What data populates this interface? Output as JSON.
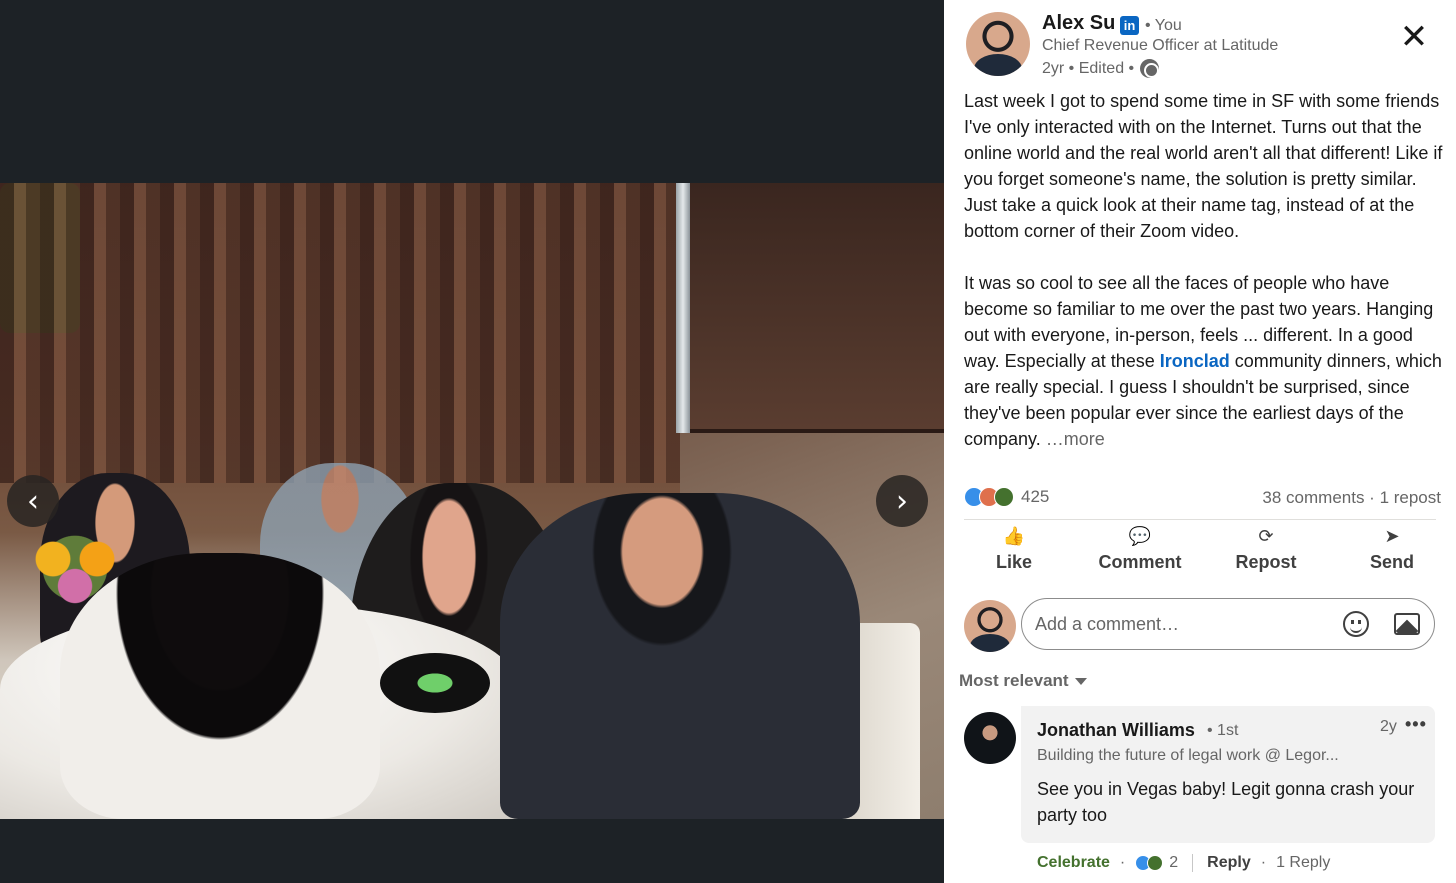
{
  "viewer": {
    "prev_icon": "‹",
    "next_icon": "›"
  },
  "post": {
    "author": {
      "name": "Alex Su",
      "badge": "in",
      "relation": "• You",
      "headline": "Chief Revenue Officer at Latitude",
      "meta": "2yr • Edited •"
    },
    "close_icon": "✕",
    "text": {
      "p1": "Last week I got to spend some time in SF with some friends I've only interacted with on the Internet. Turns out that the online world and the real world aren't all that different! Like if you forget someone's name, the solution is pretty similar. Just take a quick look at their name tag, instead of at the bottom corner of their Zoom video.",
      "p2_before": "It was so cool to see all the faces of people who have become so familiar to me over the past two years. Hanging out with everyone, in-person, feels ... different. In a good way. Especially at these ",
      "p2_mention": "Ironclad",
      "p2_after": " community dinners, which are really special. I guess I shouldn't be surprised, since they've been popular ever since the earliest days of the company.  ",
      "more": "…more"
    },
    "reaction_count": "425",
    "comments": "38 comments",
    "separator": " · ",
    "reposts": "1 repost"
  },
  "actions": [
    {
      "icon": "👍",
      "label": "Like"
    },
    {
      "icon": "💬",
      "label": "Comment"
    },
    {
      "icon": "⟳",
      "label": "Repost"
    },
    {
      "icon": "➤",
      "label": "Send"
    }
  ],
  "comment_input": {
    "placeholder": "Add a comment…"
  },
  "sort": {
    "label": "Most relevant"
  },
  "comment": {
    "name": "Jonathan Williams",
    "degree": "• 1st",
    "time": "2y",
    "menu": "•••",
    "headline": "Building the future of legal work @ Legor...",
    "text": "See you in Vegas baby! Legit gonna crash your party too",
    "celebrate": "Celebrate",
    "dot": "·",
    "reaction_count": "2",
    "reply": "Reply",
    "replies": "1 Reply"
  },
  "colors": {
    "brand_blue": "#0a66c2",
    "celebrate_green": "#44712e",
    "viewer_bg": "#1d2226"
  }
}
